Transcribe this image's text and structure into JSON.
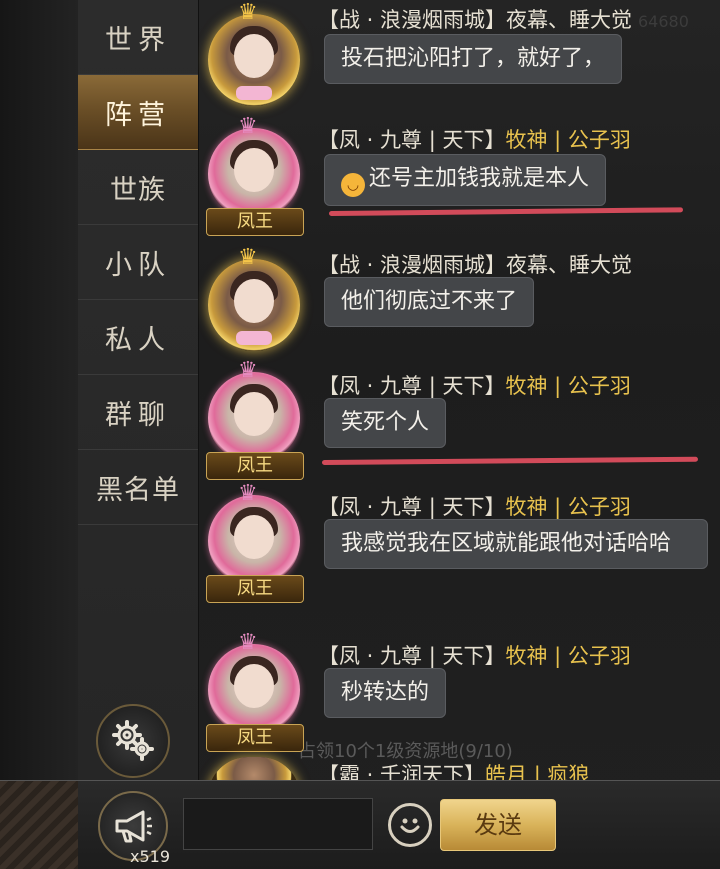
{
  "nav": {
    "items": [
      {
        "label": "世界"
      },
      {
        "label": "阵营"
      },
      {
        "label": "世族"
      },
      {
        "label": "小队"
      },
      {
        "label": "私人"
      },
      {
        "label": "群聊"
      },
      {
        "label": "黑名单"
      }
    ],
    "active_index": 1
  },
  "background_text": {
    "top_number": "64680",
    "system_notice": "占领10个1级资源地(9/10)"
  },
  "messages": [
    {
      "prefix": "【战 · 浪漫烟雨城】夜幕、睡大觉",
      "guild": "",
      "sep": "",
      "name": "",
      "text": "投石把沁阳打了，就好了，",
      "avatar": "gold",
      "rank": ""
    },
    {
      "prefix": "【凤 · 九尊 | 天下】",
      "guild": "牧神",
      "sep": " | ",
      "name": "公子羽",
      "text": "还号主加钱我就是本人",
      "avatar": "rose",
      "rank": "凤王",
      "emoji": "smile-emoji"
    },
    {
      "prefix": "【战 · 浪漫烟雨城】夜幕、睡大觉",
      "guild": "",
      "sep": "",
      "name": "",
      "text": "他们彻底过不来了",
      "avatar": "gold",
      "rank": ""
    },
    {
      "prefix": "【凤 · 九尊 | 天下】",
      "guild": "牧神",
      "sep": " | ",
      "name": "公子羽",
      "text": "笑死个人",
      "avatar": "rose",
      "rank": "凤王"
    },
    {
      "prefix": "【凤 · 九尊 | 天下】",
      "guild": "牧神",
      "sep": " | ",
      "name": "公子羽",
      "text": "我感觉我在区域就能跟他对话哈哈",
      "avatar": "rose",
      "rank": "凤王"
    },
    {
      "prefix": "【凤 · 九尊 | 天下】",
      "guild": "牧神",
      "sep": " | ",
      "name": "公子羽",
      "text": "秒转达的",
      "avatar": "rose",
      "rank": "凤王"
    },
    {
      "prefix": "【霸 · 千润天下】",
      "guild": "皓月",
      "sep": " | ",
      "name": "疯狼",
      "text": "",
      "avatar": "gold",
      "rank": ""
    }
  ],
  "bottom": {
    "horn_count": "x519",
    "input_value": "",
    "input_placeholder": "",
    "send_label": "发送"
  },
  "colors": {
    "accent_gold": "#e8c24e",
    "annotation_red": "#d24b5a",
    "bubble": "#444649"
  }
}
